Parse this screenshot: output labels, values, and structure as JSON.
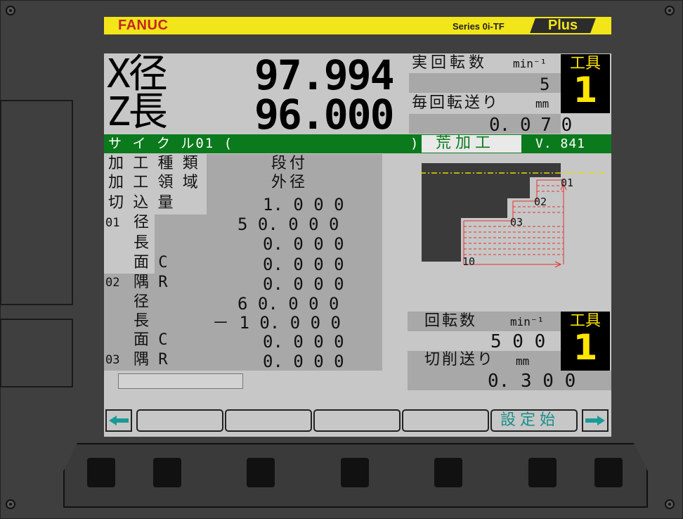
{
  "brand": {
    "name": "FANUC",
    "series": "Series 0i-TF",
    "plus": "Plus"
  },
  "position": {
    "x_label": "X径",
    "x_value": "97.994",
    "z_label": "Z長",
    "z_value": "96.000"
  },
  "top_info": {
    "spindle_label": "実回転数",
    "spindle_unit": "min⁻¹",
    "spindle_value": "5",
    "feed_label": "毎回転送り",
    "feed_unit": "mm",
    "feed_value": "0. 0 7 0",
    "tool_label": "工具",
    "tool_value": "1"
  },
  "banner": {
    "cycle": "サ イ ク ル01 (",
    "close": ")",
    "mode": "荒加工",
    "version": "V. 841"
  },
  "params": {
    "kind_label": "加 工 種 類",
    "kind_value": "段付",
    "area_label": "加 工 領 域",
    "area_value": "外径",
    "depth_label": "切 込 量",
    "depth_value": "1. 0 0 0",
    "s01_num": "01",
    "s01_dia_label": "径",
    "s01_dia_value": "5 0. 0 0 0",
    "s01_len_label": "長",
    "s01_len_value": "0. 0 0 0",
    "s01_chamfer_label": "面 C",
    "s01_chamfer_value": "0. 0 0 0",
    "s02_num": "02",
    "s02_corner_label": "隅 R",
    "s02_corner_value": "0. 0 0 0",
    "s02_dia_label": "径",
    "s02_dia_value": "6 0. 0 0 0",
    "s02_len_label": "長",
    "s02_len_value": "－ 1 0. 0 0 0",
    "s02_chamfer_label": "面 C",
    "s02_chamfer_value": "0. 0 0 0",
    "s03_num": "03",
    "s03_corner_label": "隅 R",
    "s03_corner_value": "0. 0 0 0"
  },
  "diagram": {
    "p1": "01",
    "p2": "02",
    "p3": "03",
    "p10": "10"
  },
  "bottom_info": {
    "rpm_label": "回転数",
    "rpm_unit": "min⁻¹",
    "rpm_value": "5 0 0",
    "feed_label": "切削送り",
    "feed_unit": "mm",
    "feed_value": "0. 3 0 0",
    "tool_label": "工具",
    "tool_value": "1"
  },
  "softkeys": {
    "k1": "",
    "k2": "",
    "k3": "",
    "k4": "",
    "k5": "設定始"
  },
  "colors": {
    "screen": "#c7c7c7",
    "green": "#0a7a1d",
    "yellow": "#ffe600",
    "fanuc_yellow": "#f2e519",
    "fanuc_red": "#c3261e",
    "toolpath": "#e53030"
  }
}
